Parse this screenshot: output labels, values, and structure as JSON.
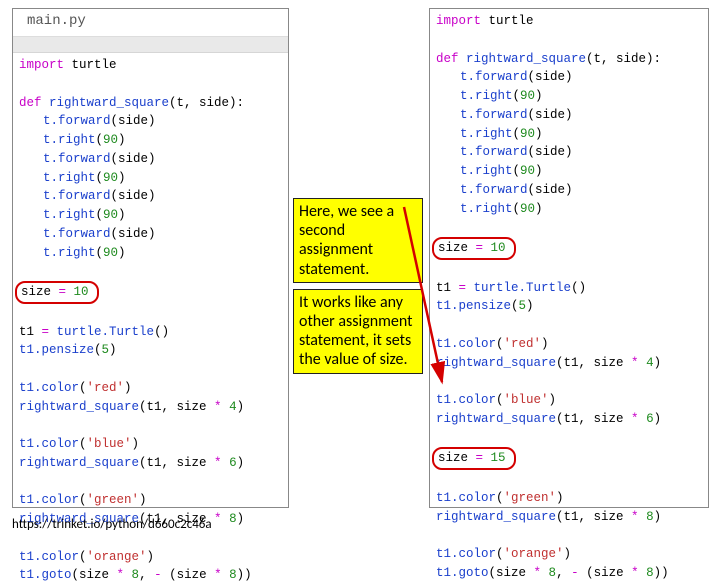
{
  "tab_label": "main.py",
  "code_left": {
    "l1_kw": "import",
    "l1_mod": " turtle",
    "l2_kw": "def",
    "l2_fn": " rightward_square",
    "l2_sig": "(t, side):",
    "l3_fn": "t.forward",
    "l3_open": "(",
    "l3_arg": "side",
    "l3_close": ")",
    "l4_fn": "t.right",
    "l4_open": "(",
    "l4_num": "90",
    "l4_close": ")",
    "size_line_var": "size ",
    "size_line_op": "=",
    "size_line_val": " 10",
    "t1a": "t1 ",
    "t1a_op": "=",
    "t1a_fn": " turtle.Turtle",
    "t1a_call": "()",
    "t1b_fn": "t1.pensize",
    "t1b_open": "(",
    "t1b_num": "5",
    "t1b_close": ")",
    "c_red_fn": "t1.color",
    "c_red_open": "(",
    "c_red_str": "'red'",
    "c_red_close": ")",
    "sq_fn": "rightward_square",
    "sq_open": "(t1, size ",
    "sq_op": "*",
    "sq_close": ")",
    "sq4_num": " 4",
    "c_blue_str": "'blue'",
    "sq6_num": " 6",
    "c_green_str": "'green'",
    "sq8_num": " 8",
    "c_orange_str": "'orange'",
    "goto_fn": "t1.goto",
    "goto_open": "(size ",
    "goto_op": "*",
    "goto_num1": " 8",
    "goto_sep": ", ",
    "goto_neg": "-",
    "goto_paren": " (size ",
    "goto_num2": " 8",
    "goto_close": "))"
  },
  "code_right": {
    "size2_var": "size ",
    "size2_op": "=",
    "size2_val": " 15"
  },
  "notes": {
    "a": "Here, we see a second assignment statement.",
    "b": "It works like any other assignment statement, it sets the value of size."
  },
  "url": "https://trinket.io/python/d660c2c46a"
}
